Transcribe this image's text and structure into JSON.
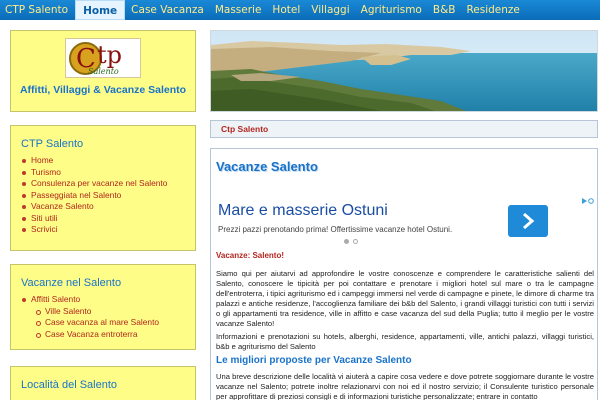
{
  "nav": {
    "brand": "CTP Salento",
    "items": [
      {
        "label": "Home",
        "active": true
      },
      {
        "label": "Case Vacanza"
      },
      {
        "label": "Masserie"
      },
      {
        "label": "Hotel"
      },
      {
        "label": "Villaggi"
      },
      {
        "label": "Agriturismo"
      },
      {
        "label": "B&B"
      },
      {
        "label": "Residenze"
      }
    ]
  },
  "logo": {
    "mark": "C",
    "word": "tp",
    "sub": "Salento",
    "title": "Affitti, Villaggi & Vacanze Salento"
  },
  "sidebar": {
    "box1": {
      "title": "CTP Salento",
      "items": [
        "Home",
        "Turismo",
        "Consulenza per vacanze nel Salento",
        "Passeggiata nel Salento",
        "Vacanze Salento",
        "Siti utili",
        "Scrivici"
      ]
    },
    "box2": {
      "title": "Vacanze nel Salento",
      "items": [
        "Affitti Salento"
      ],
      "subitems": [
        "Ville Salento",
        "Case vacanza al mare Salento",
        "Case Vacanza entroterra"
      ]
    },
    "box3": {
      "title": "Località del Salento"
    }
  },
  "breadcrumb": "Ctp Salento",
  "content": {
    "title": "Vacanze Salento",
    "ad": {
      "headline": "Mare e masserie Ostuni",
      "text": "Prezzi pazzi prenotando prima! Offertissime vacanze hotel Ostuni."
    },
    "lead": "Vacanze: Salento!",
    "p1": "Siamo qui per aiutarvi ad approfondire le vostre conoscenze e comprendere le caratteristiche salienti del Salento, conoscere le tipicità per poi contattare e prenotare i migliori hotel sul mare o tra le campagne dell'entroterra, i tipici agriturismo ed i campeggi immersi nel verde di campagne e pinete, le dimore di charme tra palazzi e antiche residenze, l'accoglienza familiare dei b&b del Salento, i grandi villaggi turistici con tutti i servizi o gli appartamenti tra residence, ville in affitto e case vacanza del sud della Puglia; tutto il meglio per le vostre vacanze Salento!",
    "p2": "Informazioni e prenotazioni su hotels, alberghi, residence, appartamenti, ville, antichi palazzi, villaggi turistici, b&b e agriturismo del Salento",
    "h2": "Le migliori proposte per Vacanze Salento",
    "p3": "Una breve descrizione delle località vi aiuterà a capire cosa vedere e dove potrete soggiornare durante le vostre vacanze nel Salento; potrete inoltre relazionarvi con noi ed il nostro servizio; il Consulente turistico personale per approfittare di preziosi consigli e di informazioni turistiche personalizzate; entrare in contatto"
  }
}
